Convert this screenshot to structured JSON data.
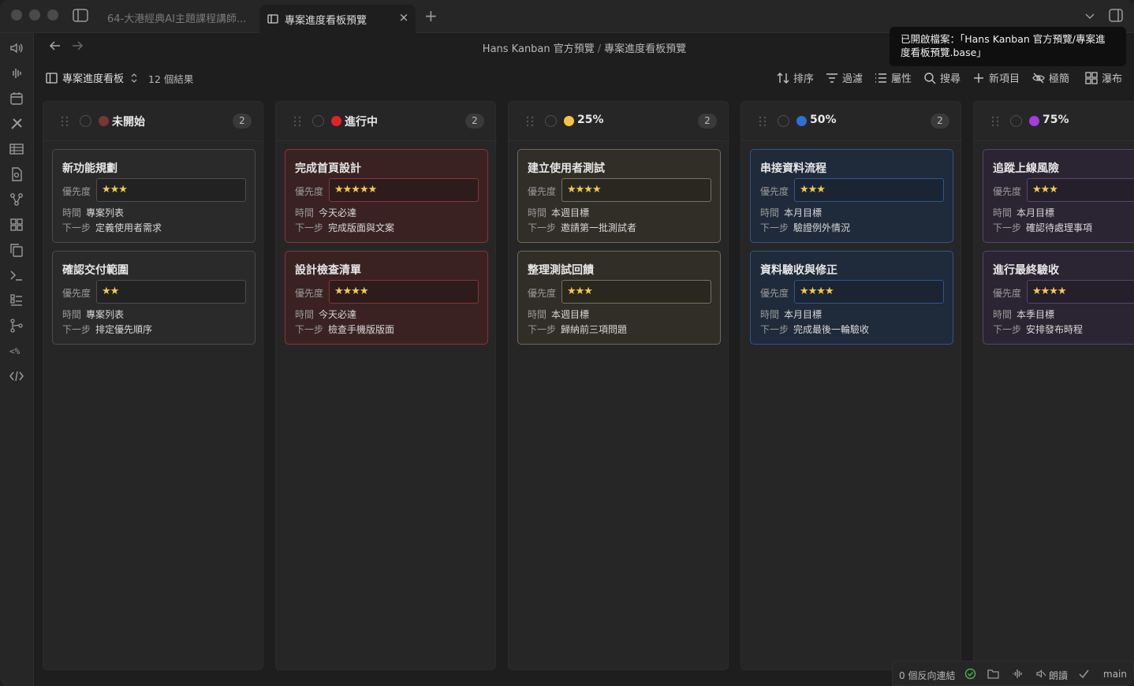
{
  "tabs": [
    {
      "label": "64-大港經典AI主題課程講師...",
      "active": false
    },
    {
      "label": "專案進度看板預覽",
      "active": true
    }
  ],
  "breadcrumb": {
    "parent": "Hans Kanban 官方預覽",
    "separator": "/",
    "current": "專案進度看板預覽"
  },
  "toast": {
    "line1": "已開啟檔案：「Hans Kanban 官方預覽/專案進",
    "line2": "度看板預覽.base」"
  },
  "toolbar": {
    "view_name": "專案進度看板",
    "result_count": "12 個結果",
    "sort": "排序",
    "filter": "過濾",
    "properties": "屬性",
    "search": "搜尋",
    "new_item": "新項目",
    "minimal": "極簡",
    "waterfall": "瀑布"
  },
  "colors": {
    "red": "#d92b2b",
    "yellow": "#f5c542",
    "blue": "#2f6fd6",
    "purple": "#a43ddc",
    "brown": "#8a3a3a",
    "star": "#f2c94c"
  },
  "labels": {
    "priority": "優先度",
    "time": "時間",
    "next": "下一步"
  },
  "columns": [
    {
      "title": "未開始",
      "count": "2",
      "dot": "#7a3535",
      "cards": [
        {
          "title": "新功能規劃",
          "priority": "★★★",
          "time": "專案列表",
          "next": "定義使用者需求"
        },
        {
          "title": "確認交付範圍",
          "priority": "★★",
          "time": "專案列表",
          "next": "排定優先順序"
        }
      ]
    },
    {
      "title": "進行中",
      "count": "2",
      "dot": "#e02424",
      "cards": [
        {
          "title": "完成首頁設計",
          "priority": "★★★★★",
          "time": "今天必達",
          "next": "完成版面與文案"
        },
        {
          "title": "設計檢查清單",
          "priority": "★★★★",
          "time": "今天必達",
          "next": "檢查手機版版面"
        }
      ]
    },
    {
      "title": "25%",
      "count": "2",
      "dot": "#f5c542",
      "cards": [
        {
          "title": "建立使用者測試",
          "priority": "★★★★",
          "time": "本週目標",
          "next": "邀請第一批測試者"
        },
        {
          "title": "整理測試回饋",
          "priority": "★★★",
          "time": "本週目標",
          "next": "歸納前三項問題"
        }
      ]
    },
    {
      "title": "50%",
      "count": "2",
      "dot": "#2f6fd6",
      "cards": [
        {
          "title": "串接資料流程",
          "priority": "★★★",
          "time": "本月目標",
          "next": "驗證例外情況"
        },
        {
          "title": "資料驗收與修正",
          "priority": "★★★★",
          "time": "本月目標",
          "next": "完成最後一輪驗收"
        }
      ]
    },
    {
      "title": "75%",
      "count": "",
      "dot": "#a43ddc",
      "cards": [
        {
          "title": "追蹤上線風險",
          "priority": "★★★",
          "time": "本月目標",
          "next": "確認待處理事項"
        },
        {
          "title": "進行最終驗收",
          "priority": "★★★★",
          "time": "本季目標",
          "next": "安排發布時程"
        }
      ]
    }
  ],
  "statusbar": {
    "backlinks": "0 個反向連結",
    "read_aloud": "朗讀",
    "branch": "main"
  }
}
